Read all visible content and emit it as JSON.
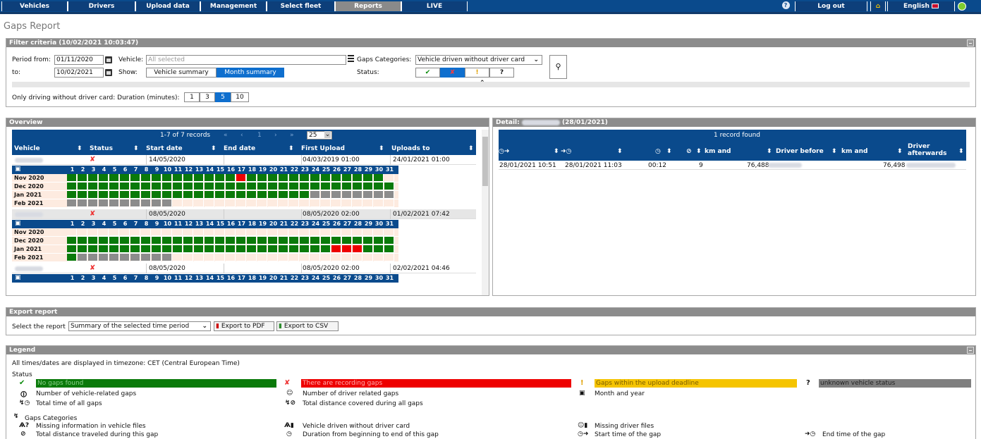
{
  "nav": {
    "tabs": [
      "Vehicles",
      "Drivers",
      "Upload data",
      "Management",
      "Select fleet",
      "Reports",
      "LIVE"
    ],
    "active": "Reports",
    "help": "?",
    "logout": "Log out",
    "home": "⌂",
    "language": "English"
  },
  "page_title": "Gaps Report",
  "filter": {
    "header": "Filter criteria (10/02/2021 10:03:47)",
    "period_from_label": "Period from:",
    "period_from": "01/11/2020",
    "to_label": "to:",
    "to": "10/02/2021",
    "vehicle_label": "Vehicle:",
    "vehicle_placeholder": "All selected",
    "show_label": "Show:",
    "show_options": [
      "Vehicle summary",
      "Month summary"
    ],
    "show_selected": "Month summary",
    "gaps_categories_label": "Gaps Categories:",
    "gaps_categories_value": "Vehicle driven without driver card",
    "status_label": "Status:",
    "status_options": [
      "✔",
      "✘",
      "!",
      "?"
    ],
    "status_selected": "✘",
    "duration_label": "Only driving without driver card: Duration (minutes):",
    "duration_options": [
      "1",
      "3",
      "5",
      "10"
    ],
    "duration_selected": "5"
  },
  "overview": {
    "header": "Overview",
    "records": "1-7 of 7 records",
    "pagination": [
      "«",
      "‹",
      "1",
      "›",
      "»"
    ],
    "page_size": "25",
    "columns": [
      "Vehicle",
      "Status",
      "Start date",
      "End date",
      "First Upload",
      "Uploads to"
    ],
    "day_numbers": [
      "1",
      "2",
      "3",
      "4",
      "5",
      "6",
      "7",
      "8",
      "9",
      "10",
      "11",
      "12",
      "13",
      "14",
      "15",
      "16",
      "17",
      "18",
      "19",
      "20",
      "21",
      "22",
      "23",
      "24",
      "25",
      "26",
      "27",
      "28",
      "29",
      "30",
      "31"
    ],
    "vehicles": [
      {
        "start": "14/05/2020",
        "end": "",
        "first": "04/03/2019 01:00",
        "to": "24/01/2021 01:00",
        "months": [
          {
            "label": "Nov 2020",
            "cells": "ggggggggggggggggrgggggggggggggw"
          },
          {
            "label": "Dec 2020",
            "cells": "ggggggggggggggggggggggggggggggg"
          },
          {
            "label": "Jan 2021",
            "cells": "gggggggggggggggggggggggbbbbbbbb"
          },
          {
            "label": "Feb 2021",
            "cells": "bbbbbbbbbbwwwwwwwwwwwwwwwwwwwww"
          }
        ]
      },
      {
        "start": "08/05/2020",
        "end": "",
        "first": "08/05/2020 02:00",
        "to": "01/02/2021 07:42",
        "months": [
          {
            "label": "Nov 2020",
            "cells": "wwwwwwwwwwwwwwwwwwwwwwwwwwwwwww"
          },
          {
            "label": "Dec 2020",
            "cells": "ggggggggggggggggggggggggggggggg"
          },
          {
            "label": "Jan 2021",
            "cells": "gggggggggggggggggggggggggrrrggg"
          },
          {
            "label": "Feb 2021",
            "cells": "gbbbbbbbbbwwwwwwwwwwwwwwwwwwwww"
          }
        ]
      },
      {
        "start": "08/05/2020",
        "end": "",
        "first": "08/05/2020 02:00",
        "to": "02/02/2021 04:46",
        "months": []
      }
    ]
  },
  "detail": {
    "header_prefix": "Detail:",
    "header_suffix": "(28/01/2021)",
    "records": "1 record found",
    "columns": [
      "◷➜",
      "➜◷",
      "",
      "◷",
      "⊘",
      "km and",
      "Driver before",
      "km and",
      "Driver afterwards"
    ],
    "rows": [
      {
        "start": "28/01/2021 10:51",
        "end": "28/01/2021 11:03",
        "duration": "00:12",
        "distance": "9",
        "km_start": "76,488",
        "km_end": "76,498"
      }
    ]
  },
  "export": {
    "header": "Export report",
    "select_label": "Select the report",
    "select_value": "Summary of the selected time period",
    "pdf_button": "Export to PDF",
    "csv_button": "Export to CSV"
  },
  "legend": {
    "header": "Legend",
    "timezone": "All times/dates are displayed in timezone: CET (Central European Time)",
    "status_title": "Status",
    "no_gaps": "No gaps found",
    "recording_gaps": "There are recording gaps",
    "within_deadline": "Gaps within the upload deadline",
    "unknown": "unknown vehicle status",
    "vehicle_gaps": "Number of vehicle-related gaps",
    "driver_gaps": "Number of driver related gaps",
    "month_year": "Month and year",
    "total_time": "Total time of all gaps",
    "total_distance": "Total distance covered during all gaps",
    "categories_title": "Gaps Categories",
    "missing_vehicle": "Missing information in vehicle files",
    "without_card": "Vehicle driven without driver card",
    "missing_driver": "Missing driver files",
    "distance_gap": "Total distance traveled during this gap",
    "duration_gap": "Duration from beginning to end of this gap",
    "start_time": "Start time of the gap",
    "end_time": "End time of the gap",
    "colors": {
      "green": "#0a7a0a",
      "red": "#ee0000",
      "yellow": "#f5c400",
      "grey": "#7f7f7f"
    }
  }
}
